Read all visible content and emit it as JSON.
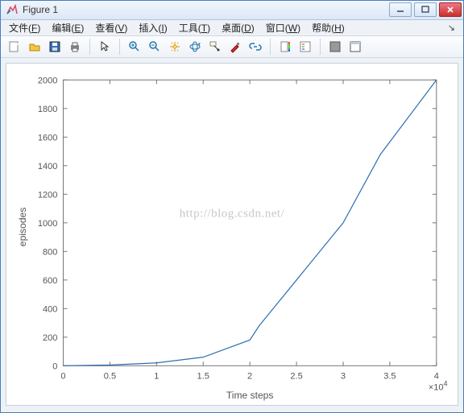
{
  "window": {
    "title": "Figure 1",
    "buttons": {
      "minimize": "minimize",
      "maximize": "maximize",
      "close": "close"
    }
  },
  "menubar": {
    "items": [
      {
        "label": "文件",
        "key": "F"
      },
      {
        "label": "编辑",
        "key": "E"
      },
      {
        "label": "查看",
        "key": "V"
      },
      {
        "label": "插入",
        "key": "I"
      },
      {
        "label": "工具",
        "key": "T"
      },
      {
        "label": "桌面",
        "key": "D"
      },
      {
        "label": "窗口",
        "key": "W"
      },
      {
        "label": "帮助",
        "key": "H"
      }
    ],
    "dock_tooltip": "Dock"
  },
  "toolbar": {
    "tools": [
      "new-figure-icon",
      "open-icon",
      "save-icon",
      "print-icon",
      "|",
      "pointer-icon",
      "|",
      "zoom-in-icon",
      "zoom-out-icon",
      "pan-icon",
      "rotate3d-icon",
      "data-cursor-icon",
      "brush-icon",
      "link-icon",
      "|",
      "colorbar-icon",
      "legend-icon",
      "|",
      "hide-tools-icon",
      "show-tools-icon"
    ]
  },
  "watermark": "http://blog.csdn.net/",
  "chart_data": {
    "type": "line",
    "x_scale_note": "x axis shown ×10^4",
    "x_exponent": "×10",
    "x_exponent_sup": "4",
    "x": [
      0,
      0.5,
      1,
      1.5,
      2,
      2.1,
      2.5,
      3,
      3.4,
      4
    ],
    "y": [
      0,
      5,
      20,
      60,
      180,
      280,
      600,
      1000,
      1480,
      2000
    ],
    "xlabel": "Time steps",
    "ylabel": "episodes",
    "xlim": [
      0,
      4
    ],
    "ylim": [
      0,
      2000
    ],
    "xticks": [
      0,
      0.5,
      1,
      1.5,
      2,
      2.5,
      3,
      3.5,
      4
    ],
    "yticks": [
      0,
      200,
      400,
      600,
      800,
      1000,
      1200,
      1400,
      1600,
      1800,
      2000
    ]
  }
}
